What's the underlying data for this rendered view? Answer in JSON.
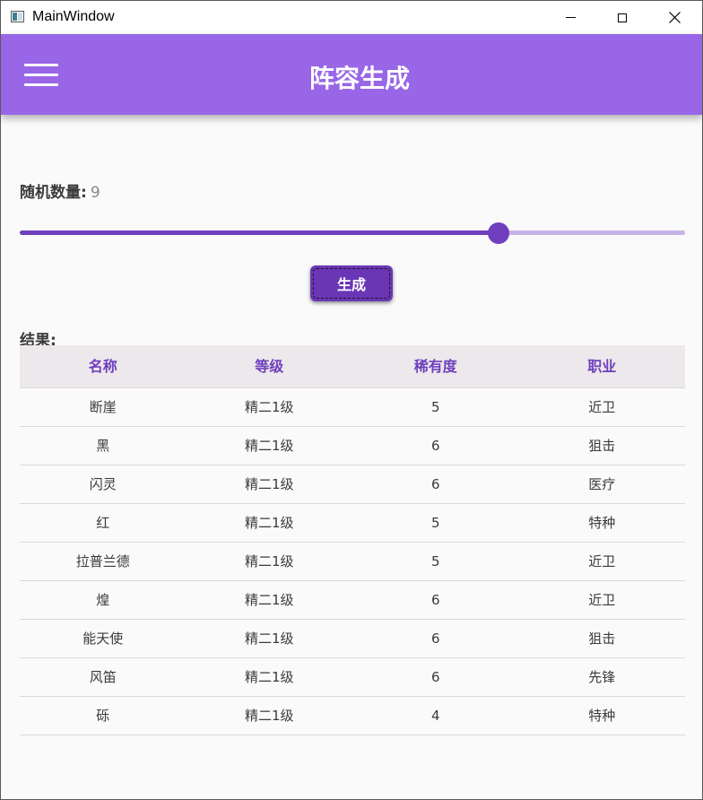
{
  "window": {
    "title": "MainWindow",
    "controls": [
      "minimize-icon",
      "maximize-icon",
      "close-icon"
    ]
  },
  "appbar": {
    "title": "阵容生成",
    "menu_icon": "hamburger-menu-icon",
    "color": "#9866e7"
  },
  "random_count": {
    "label": "随机数量:",
    "value": "9",
    "fraction": 0.72
  },
  "generate_button": {
    "label": "生成"
  },
  "result": {
    "label": "结果:",
    "columns": [
      "名称",
      "等级",
      "稀有度",
      "职业"
    ],
    "rows": [
      [
        "断崖",
        "精二1级",
        "5",
        "近卫"
      ],
      [
        "黑",
        "精二1级",
        "6",
        "狙击"
      ],
      [
        "闪灵",
        "精二1级",
        "6",
        "医疗"
      ],
      [
        "红",
        "精二1级",
        "5",
        "特种"
      ],
      [
        "拉普兰德",
        "精二1级",
        "5",
        "近卫"
      ],
      [
        "煌",
        "精二1级",
        "6",
        "近卫"
      ],
      [
        "能天使",
        "精二1级",
        "6",
        "狙击"
      ],
      [
        "风笛",
        "精二1级",
        "6",
        "先锋"
      ],
      [
        "砾",
        "精二1级",
        "4",
        "特种"
      ]
    ]
  },
  "colors": {
    "accent": "#6f3fbd",
    "accent_light": "#c6b2e6",
    "header_bg": "#ece8eb"
  }
}
